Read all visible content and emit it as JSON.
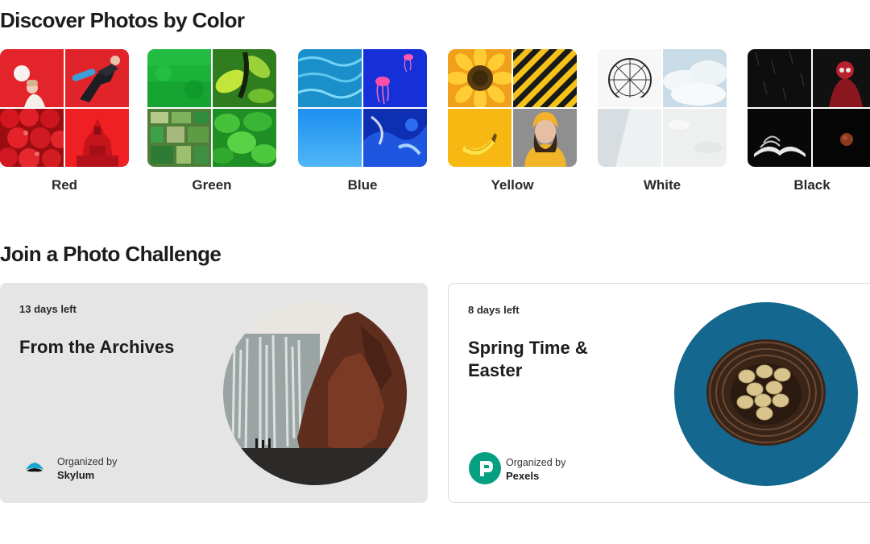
{
  "sections": {
    "colors_title": "Discover Photos by Color",
    "challenge_title": "Join a Photo Challenge"
  },
  "colors": [
    {
      "label": "Red",
      "accent": "#e8262c"
    },
    {
      "label": "Green",
      "accent": "#1fae3a"
    },
    {
      "label": "Blue",
      "accent": "#1c8fe6"
    },
    {
      "label": "Yellow",
      "accent": "#f3b400"
    },
    {
      "label": "White",
      "accent": "#eef0f1"
    },
    {
      "label": "Black",
      "accent": "#0d0d0d"
    }
  ],
  "challenges": [
    {
      "days_left": "13 days left",
      "title": "From the Archives",
      "organized_by": "Organized by",
      "organizer": "Skylum",
      "logo": "skylum-logo"
    },
    {
      "days_left": "8 days left",
      "title": "Spring Time & Easter",
      "organized_by": "Organized by",
      "organizer": "Pexels",
      "logo": "pexels-logo",
      "logo_color": "#05a081"
    }
  ]
}
